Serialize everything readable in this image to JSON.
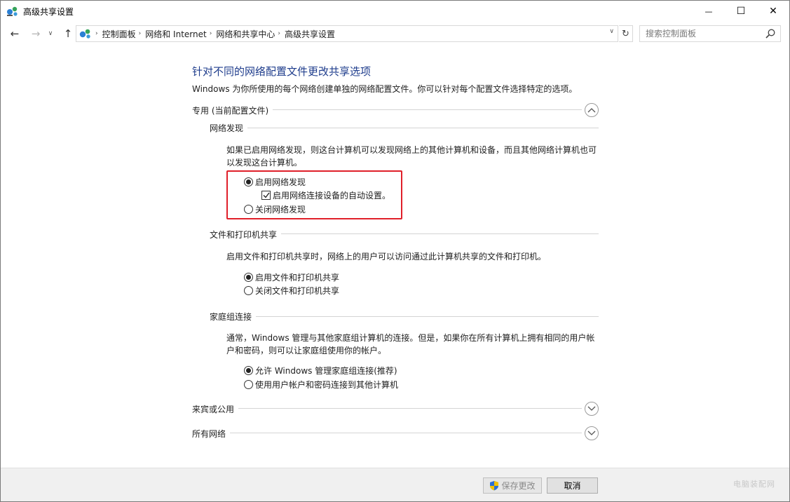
{
  "window": {
    "title": "高级共享设置",
    "minimize_glyph": "—",
    "maximize_glyph": "☐",
    "close_glyph": "✕"
  },
  "nav": {
    "breadcrumbs": [
      "控制面板",
      "网络和 Internet",
      "网络和共享中心",
      "高级共享设置"
    ],
    "search_placeholder": "搜索控制面板"
  },
  "main": {
    "heading": "针对不同的网络配置文件更改共享选项",
    "intro": "Windows 为你所使用的每个网络创建单独的网络配置文件。你可以针对每个配置文件选择特定的选项。",
    "private_profile": {
      "title": "专用 (当前配置文件)",
      "expanded": true,
      "network_discovery": {
        "title": "网络发现",
        "description": "如果已启用网络发现，则这台计算机可以发现网络上的其他计算机和设备，而且其他网络计算机也可以发现这台计算机。",
        "options": [
          {
            "label": "启用网络发现",
            "selected": true
          },
          {
            "label": "关闭网络发现",
            "selected": false
          }
        ],
        "auto_setup": {
          "label": "启用网络连接设备的自动设置。",
          "checked": true
        }
      },
      "file_printer_sharing": {
        "title": "文件和打印机共享",
        "description": "启用文件和打印机共享时，网络上的用户可以访问通过此计算机共享的文件和打印机。",
        "options": [
          {
            "label": "启用文件和打印机共享",
            "selected": true
          },
          {
            "label": "关闭文件和打印机共享",
            "selected": false
          }
        ]
      },
      "homegroup": {
        "title": "家庭组连接",
        "description": "通常，Windows 管理与其他家庭组计算机的连接。但是，如果你在所有计算机上拥有相同的用户帐户和密码，则可以让家庭组使用你的帐户。",
        "options": [
          {
            "label": "允许 Windows 管理家庭组连接(推荐)",
            "selected": true
          },
          {
            "label": "使用用户帐户和密码连接到其他计算机",
            "selected": false
          }
        ]
      }
    },
    "guest_public_profile": {
      "title": "来宾或公用",
      "expanded": false
    },
    "all_networks_profile": {
      "title": "所有网络",
      "expanded": false
    }
  },
  "footer": {
    "save_label": "保存更改",
    "cancel_label": "取消",
    "watermark": "电脑装配网"
  },
  "colors": {
    "heading": "#1e3c8c",
    "highlight_box": "#e0202a"
  }
}
